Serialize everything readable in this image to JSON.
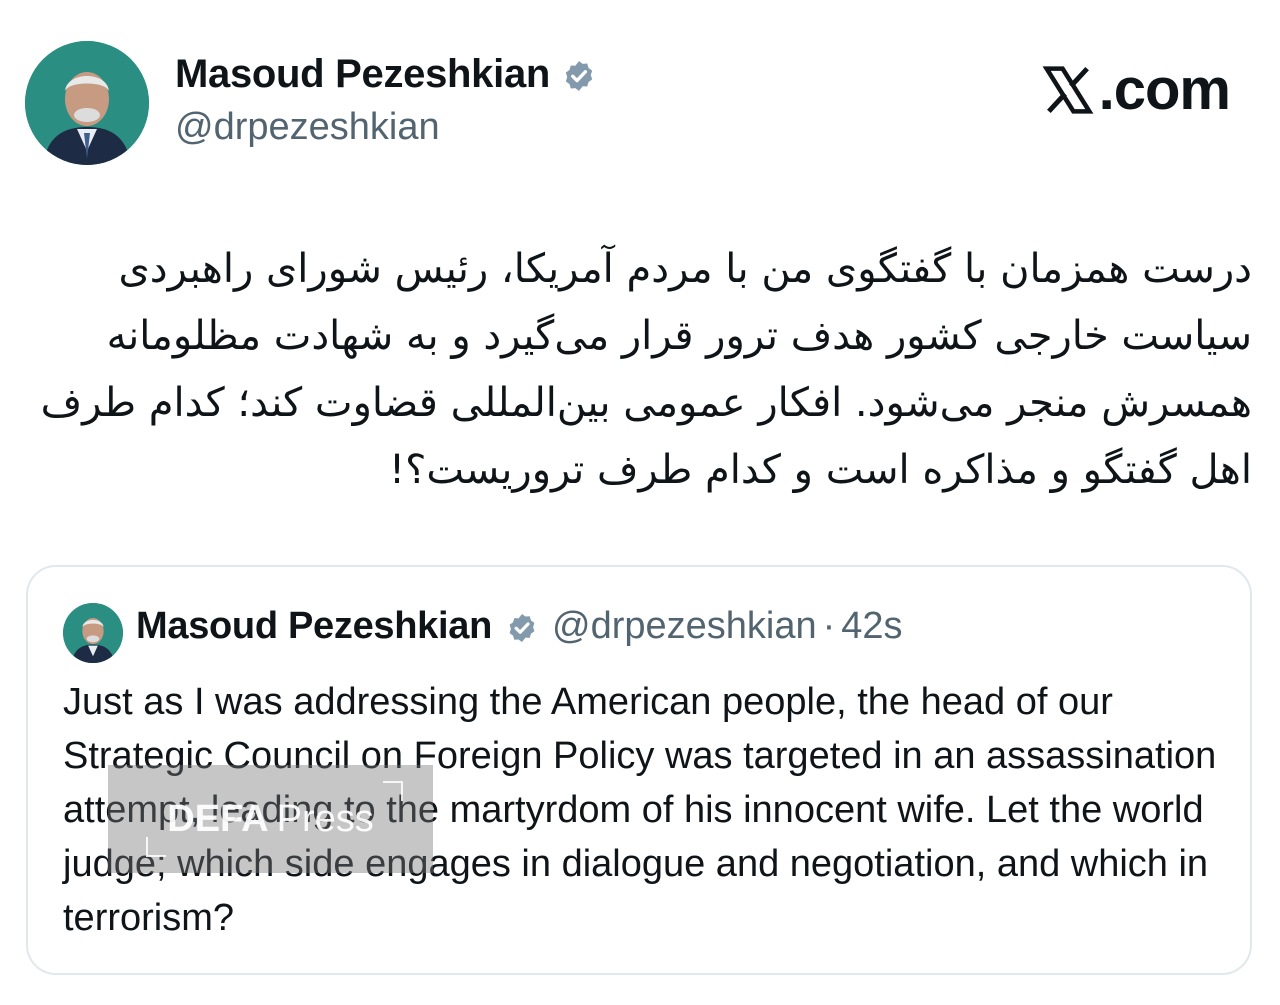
{
  "author": {
    "name": "Masoud Pezeshkian",
    "handle": "@drpezeshkian"
  },
  "brand": {
    "label": ".com"
  },
  "tweet": {
    "text": "درست همزمان با گفتگوی من با مردم آمریکا، رئیس شورای راهبردی سیاست خارجی کشور هدف ترور قرار می‌گیرد و به شهادت مظلومانه همسرش منجر می‌شود. افکار عمومی بین‌المللی قضاوت کند؛ کدام طرف اهل گفتگو و مذاکره است و کدام طرف تروریست؟!"
  },
  "quote": {
    "name": "Masoud Pezeshkian",
    "handle": "@drpezeshkian",
    "separator": "·",
    "time": "42s",
    "text": "Just as I was addressing the American people, the head of our Strategic Council on Foreign Policy was targeted in an assassination attempt, leading to the martyrdom of his innocent wife. Let the world judge; which side engages in dialogue and negotiation, and which in terrorism?"
  },
  "watermark": {
    "bold": "DEFA",
    "regular": "Press"
  },
  "colors": {
    "text": "#0f1419",
    "secondary": "#536471",
    "verified": "#829aab",
    "card_border": "#e1e8ed",
    "avatar_bg": "#2a8f82"
  },
  "icons": {
    "verified": "verified-badge-icon",
    "brand": "x-logo-icon"
  }
}
